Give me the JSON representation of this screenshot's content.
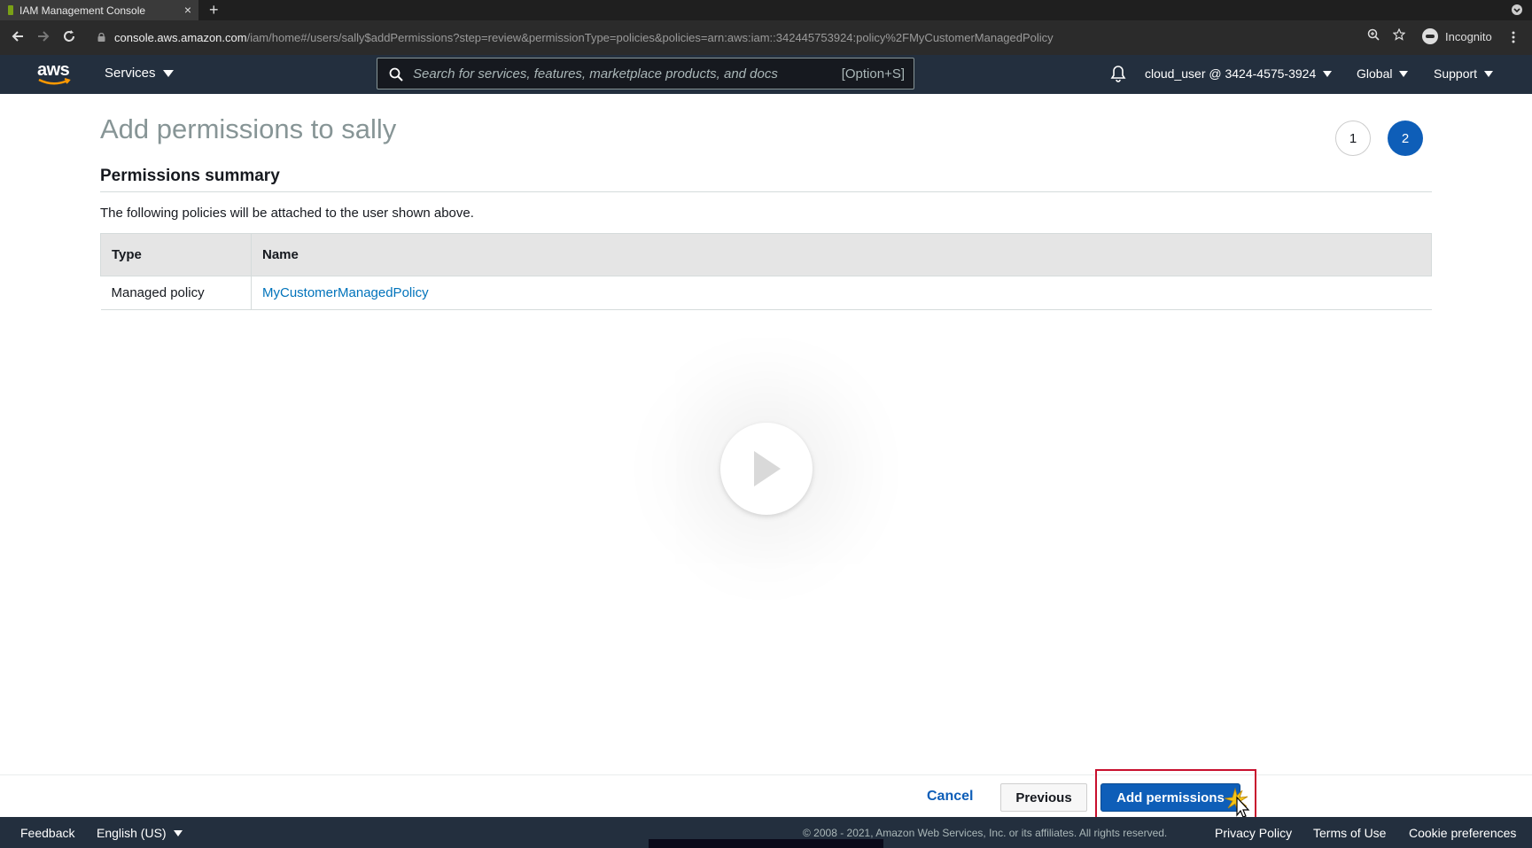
{
  "browser": {
    "tab_title": "IAM Management Console",
    "tab_close": "×",
    "new_tab": "+",
    "url_host": "console.aws.amazon.com",
    "url_path": "/iam/home#/users/sally$addPermissions?step=review&permissionType=policies&policies=arn:aws:iam::342445753924:policy%2FMyCustomerManagedPolicy",
    "profile_label": "Incognito"
  },
  "awsnav": {
    "logo_text": "aws",
    "services_label": "Services",
    "search_placeholder": "Search for services, features, marketplace products, and docs",
    "search_shortcut": "[Option+S]",
    "account_label": "cloud_user @ 3424-4575-3924",
    "region_label": "Global",
    "support_label": "Support"
  },
  "page": {
    "title": "Add permissions to sally",
    "steps": [
      "1",
      "2"
    ],
    "active_step": 2,
    "section_title": "Permissions summary",
    "description": "The following policies will be attached to the user shown above.",
    "table": {
      "headers": [
        "Type",
        "Name"
      ],
      "rows": [
        {
          "type": "Managed policy",
          "name": "MyCustomerManagedPolicy"
        }
      ]
    }
  },
  "actions": {
    "cancel_label": "Cancel",
    "previous_label": "Previous",
    "add_label": "Add permissions"
  },
  "footer": {
    "feedback": "Feedback",
    "language": "English (US)",
    "copyright": "© 2008 - 2021, Amazon Web Services, Inc. or its affiliates. All rights reserved.",
    "privacy": "Privacy Policy",
    "terms": "Terms of Use",
    "cookies": "Cookie preferences"
  },
  "colors": {
    "aws_nav_bg": "#232f3e",
    "primary_button": "#0e5eb8",
    "link": "#0073bb",
    "highlight_box": "#c8102e"
  }
}
